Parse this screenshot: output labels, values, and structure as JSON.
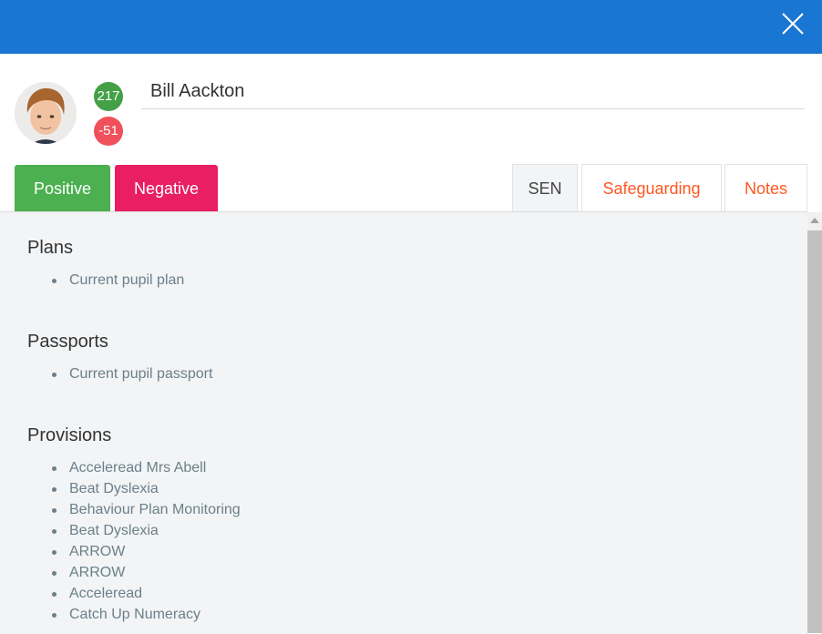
{
  "topbar": {
    "color": "#1976d2",
    "close_icon": "close-icon"
  },
  "pupil": {
    "name": "Bill Aackton",
    "positive_points": "217",
    "negative_points": "-51"
  },
  "actions": {
    "positive_label": "Positive",
    "negative_label": "Negative"
  },
  "tabs": [
    {
      "label": "SEN",
      "active": true
    },
    {
      "label": "Safeguarding",
      "active": false
    },
    {
      "label": "Notes",
      "active": false
    }
  ],
  "sections": {
    "plans": {
      "title": "Plans",
      "items": [
        "Current pupil plan"
      ]
    },
    "passports": {
      "title": "Passports",
      "items": [
        "Current pupil passport"
      ]
    },
    "provisions": {
      "title": "Provisions",
      "items": [
        "Acceleread Mrs Abell",
        "Beat Dyslexia",
        "Behaviour Plan Monitoring",
        "Beat Dyslexia",
        "ARROW",
        "ARROW",
        "Acceleread",
        "Catch Up Numeracy"
      ]
    }
  },
  "colors": {
    "positive": "#4caf50",
    "negative": "#e91e63",
    "badge_positive": "#43a047",
    "badge_negative": "#f0505a",
    "tab_link": "#ff5722"
  }
}
